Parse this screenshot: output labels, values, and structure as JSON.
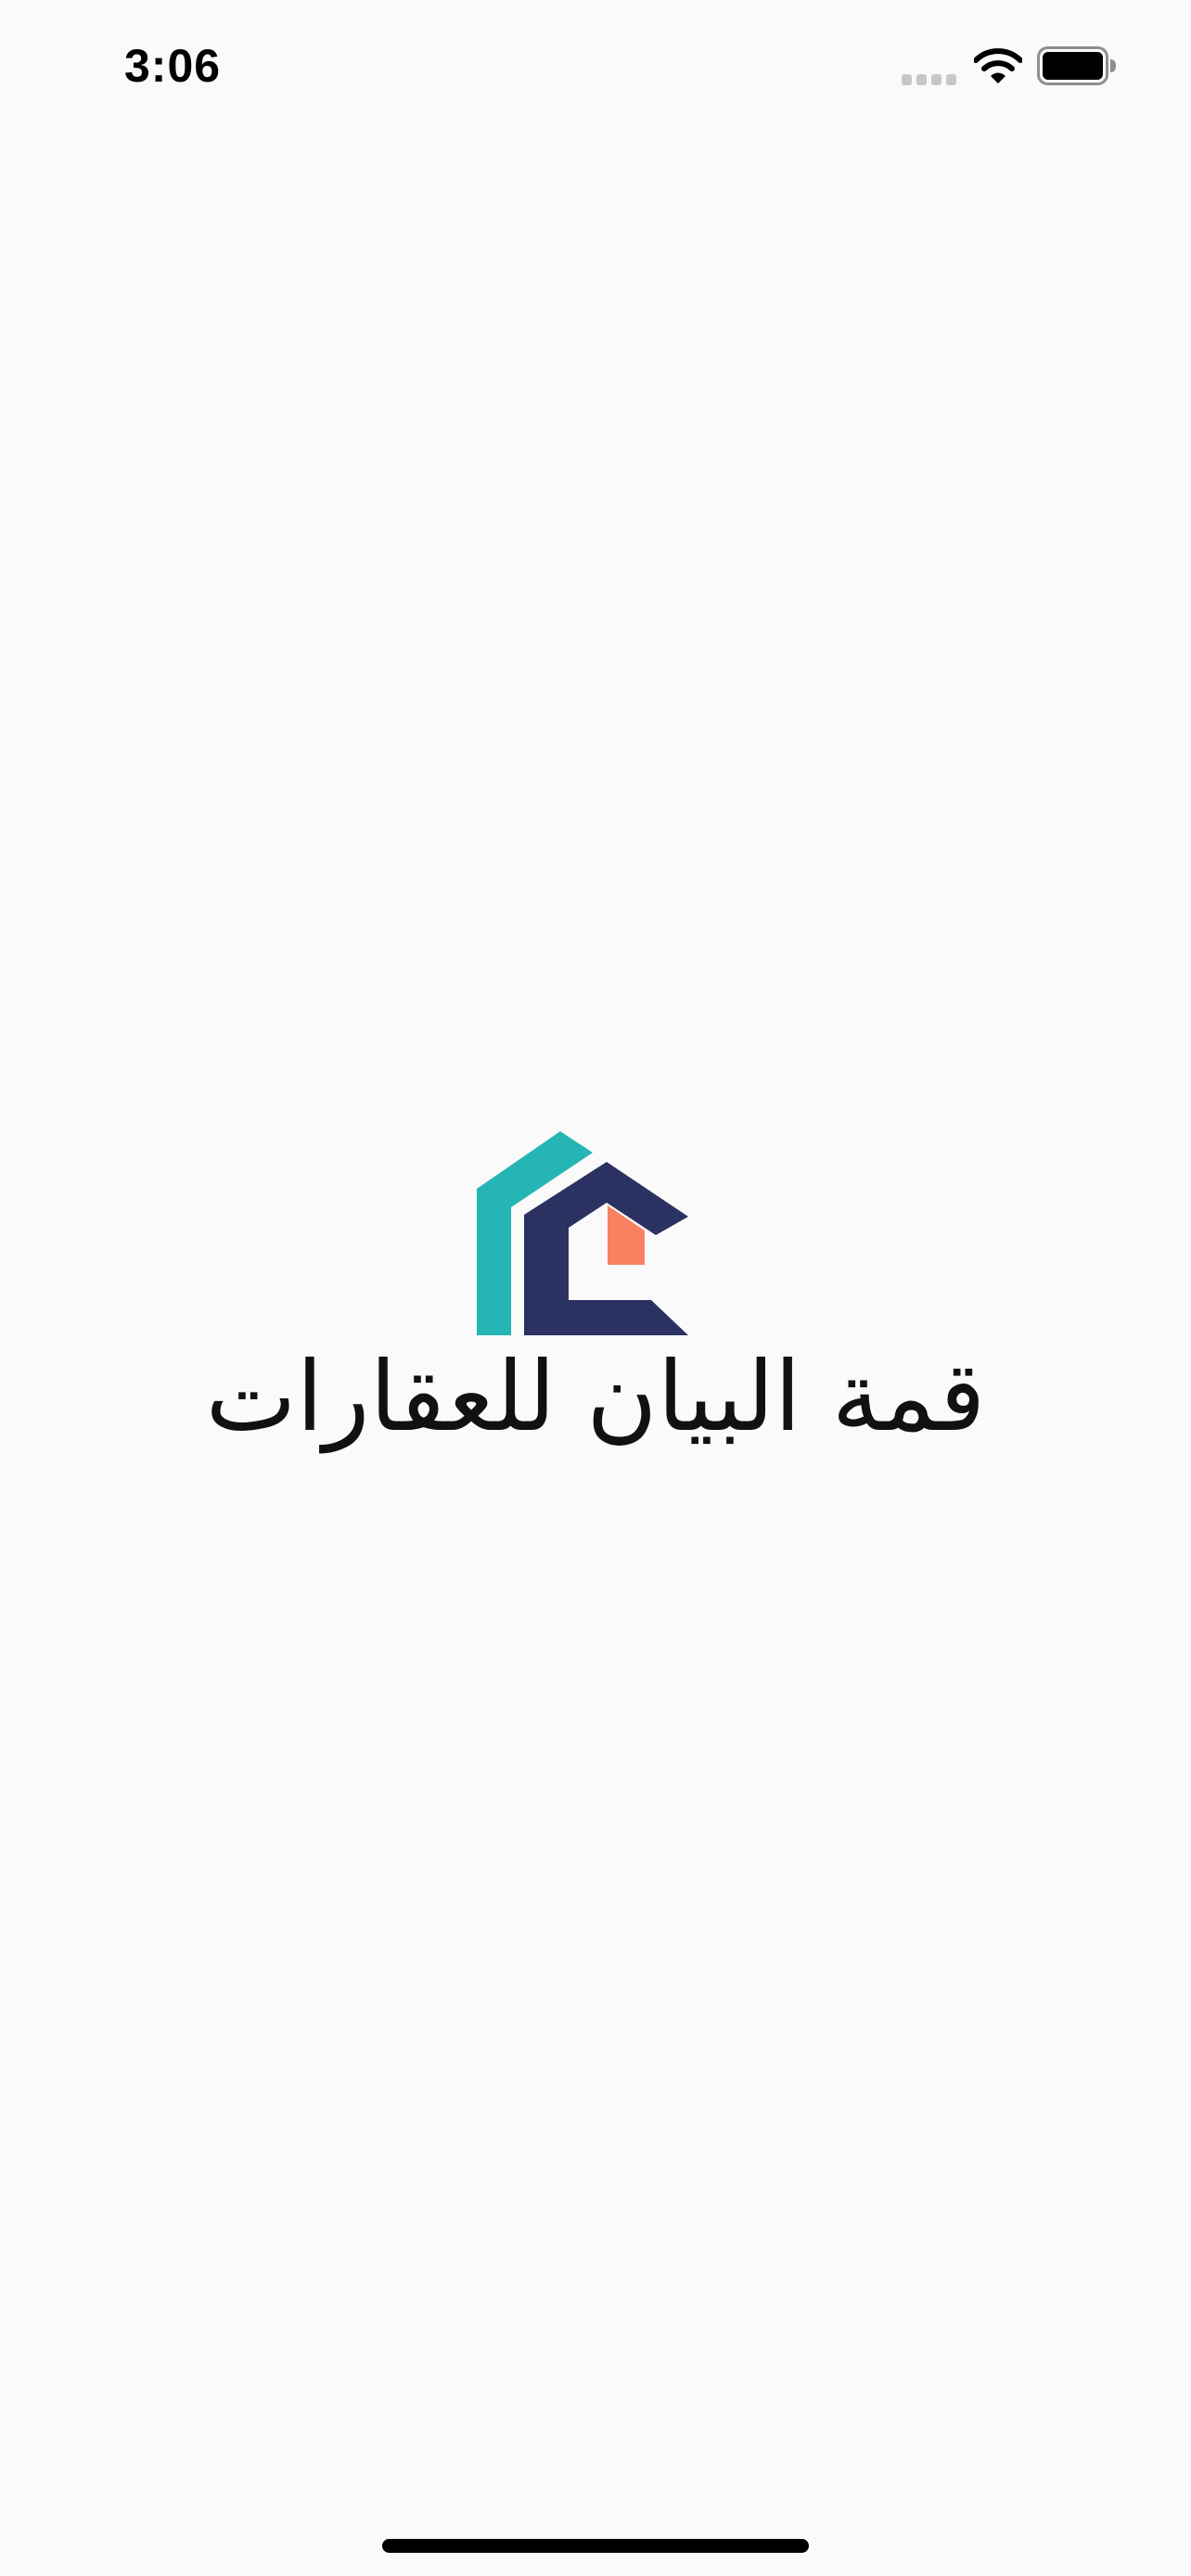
{
  "status_bar": {
    "time": "3:06",
    "icons": [
      "cellular-signal-icon",
      "wifi-icon",
      "battery-icon"
    ]
  },
  "splash": {
    "logo_icon": "house-logo-icon",
    "brand_name": "قمة البيان للعقارات",
    "colors": {
      "teal": "#26b5b5",
      "navy": "#2b3262",
      "coral": "#fa8062",
      "background": "#fafafa"
    }
  }
}
